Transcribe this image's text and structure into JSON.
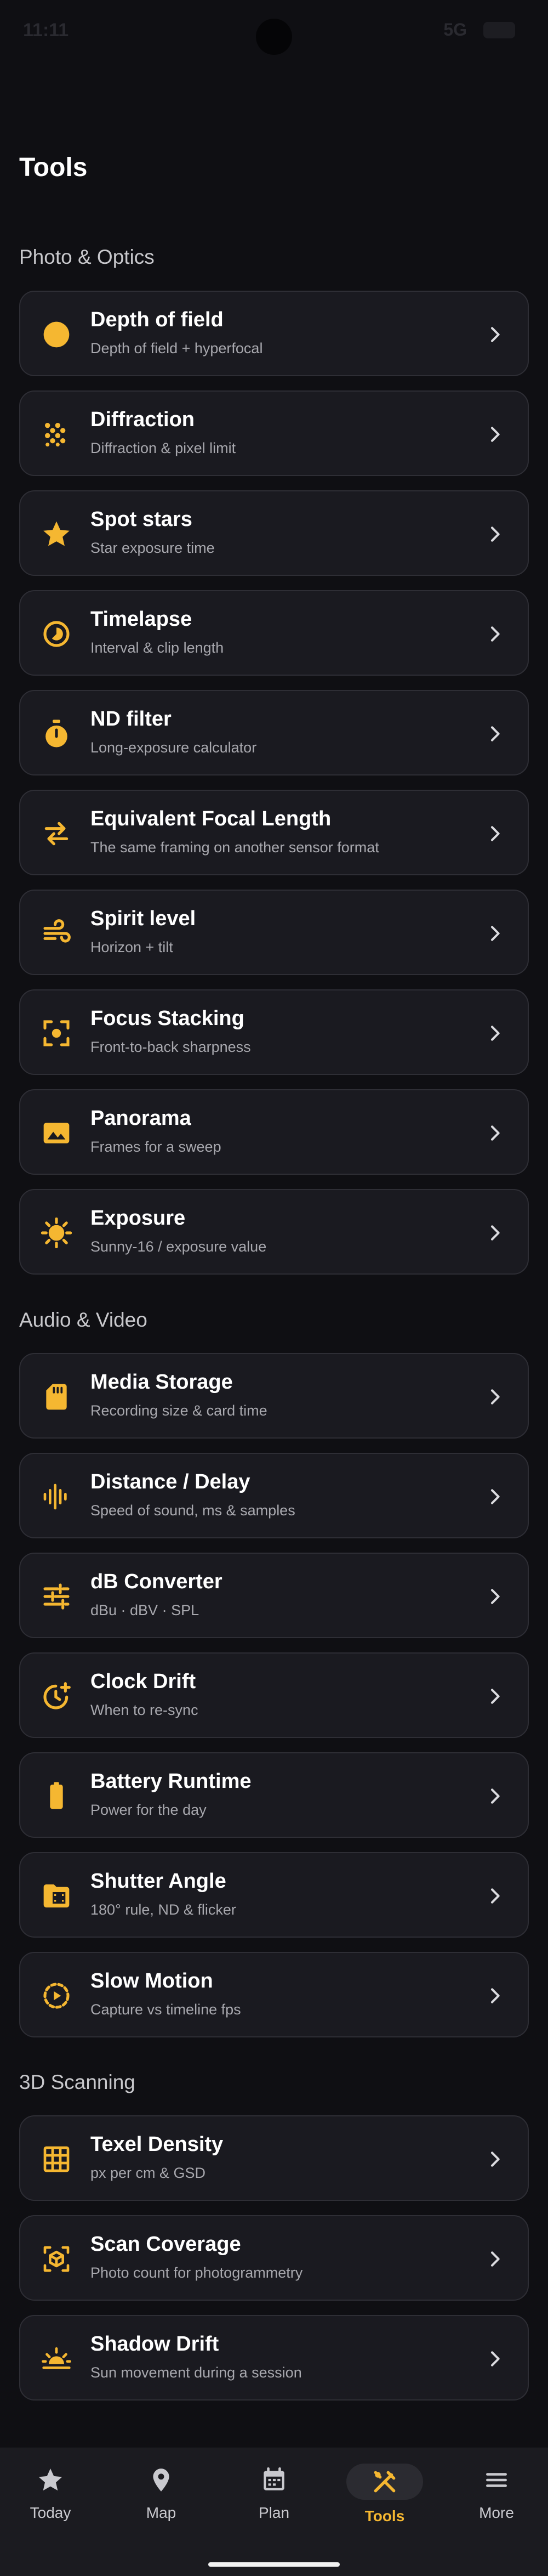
{
  "status_bar": {
    "time": "11:11",
    "network": "5G"
  },
  "page": {
    "title": "Tools"
  },
  "sections": {
    "photo": "Photo & Optics",
    "audio": "Audio & Video",
    "scan": "3D Scanning"
  },
  "tools": {
    "dof": {
      "title": "Depth of field",
      "subtitle": "Depth of field + hyperfocal",
      "icon": "circle-icon"
    },
    "diffraction": {
      "title": "Diffraction",
      "subtitle": "Diffraction & pixel limit",
      "icon": "grain-icon"
    },
    "spot_stars": {
      "title": "Spot stars",
      "subtitle": "Star exposure time",
      "icon": "star-icon"
    },
    "timelapse": {
      "title": "Timelapse",
      "subtitle": "Interval & clip length",
      "icon": "timelapse-icon"
    },
    "nd_filter": {
      "title": "ND filter",
      "subtitle": "Long-exposure calculator",
      "icon": "timer-icon"
    },
    "focal_length": {
      "title": "Equivalent Focal Length",
      "subtitle": "The same framing on another sensor format",
      "icon": "swap-arrows-icon"
    },
    "spirit_level": {
      "title": "Spirit level",
      "subtitle": "Horizon + tilt",
      "icon": "air-lines-icon"
    },
    "focus_stacking": {
      "title": "Focus Stacking",
      "subtitle": "Front-to-back sharpness",
      "icon": "center-focus-icon"
    },
    "panorama": {
      "title": "Panorama",
      "subtitle": "Frames for a sweep",
      "icon": "image-icon"
    },
    "exposure": {
      "title": "Exposure",
      "subtitle": "Sunny-16 / exposure value",
      "icon": "sun-icon"
    },
    "media_storage": {
      "title": "Media Storage",
      "subtitle": "Recording size & card time",
      "icon": "sd-card-icon"
    },
    "distance_delay": {
      "title": "Distance / Delay",
      "subtitle": "Speed of sound, ms & samples",
      "icon": "waveform-icon"
    },
    "db_converter": {
      "title": "dB Converter",
      "subtitle": "dBu · dBV · SPL",
      "icon": "sliders-icon"
    },
    "clock_drift": {
      "title": "Clock Drift",
      "subtitle": "When to re-sync",
      "icon": "clock-add-icon"
    },
    "battery_runtime": {
      "title": "Battery Runtime",
      "subtitle": "Power for the day",
      "icon": "battery-icon"
    },
    "shutter_angle": {
      "title": "Shutter Angle",
      "subtitle": "180° rule, ND & flicker",
      "icon": "film-folder-icon"
    },
    "slow_motion": {
      "title": "Slow Motion",
      "subtitle": "Capture vs timeline fps",
      "icon": "slow-motion-icon"
    },
    "texel_density": {
      "title": "Texel Density",
      "subtitle": "px per cm & GSD",
      "icon": "grid-icon"
    },
    "scan_coverage": {
      "title": "Scan Coverage",
      "subtitle": "Photo count for photogrammetry",
      "icon": "cube-scan-icon"
    },
    "shadow_drift": {
      "title": "Shadow Drift",
      "subtitle": "Sun movement during a session",
      "icon": "sunset-icon"
    }
  },
  "nav": {
    "today": "Today",
    "map": "Map",
    "plan": "Plan",
    "tools": "Tools",
    "more": "More",
    "active": "tools"
  },
  "colors": {
    "accent": "#f5b731",
    "background": "#0f0f13",
    "card": "#1a1a20",
    "card_border": "#2e2e35",
    "subtitle": "#a8a8ae"
  }
}
